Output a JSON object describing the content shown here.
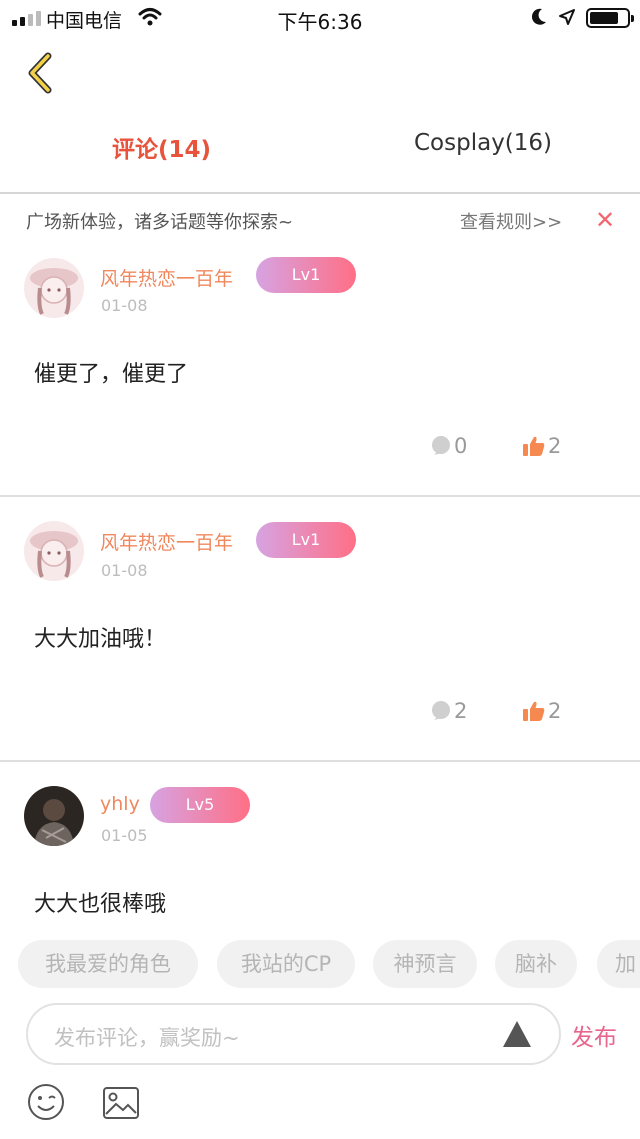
{
  "status_bar": {
    "carrier": "中国电信",
    "time": "下午6:36"
  },
  "tabs": [
    {
      "label": "评论(14)"
    },
    {
      "label": "Cosplay(16)"
    }
  ],
  "notice": {
    "text": "广场新体验，诸多话题等你探索~",
    "rules_link": "查看规则>>",
    "close": "✕"
  },
  "comments": [
    {
      "user": "风年热恋一百年",
      "level": "Lv1",
      "date": "01-08",
      "text": "催更了，催更了",
      "replies": "0",
      "likes": "2"
    },
    {
      "user": "风年热恋一百年",
      "level": "Lv1",
      "date": "01-08",
      "text": "大大加油哦！",
      "replies": "2",
      "likes": "2"
    },
    {
      "user": "yhly",
      "level": "Lv5",
      "date": "01-05",
      "text": "大大也很棒哦"
    }
  ],
  "topic_tags": [
    "我最爱的角色",
    "我站的CP",
    "神预言",
    "脑补",
    "加"
  ],
  "compose": {
    "placeholder": "发布评论，赢奖励~",
    "publish_label": "发布"
  },
  "colors": {
    "accent": "#e8533c",
    "username": "#f0885e",
    "publish": "#e8658e",
    "like": "#f5894f"
  }
}
